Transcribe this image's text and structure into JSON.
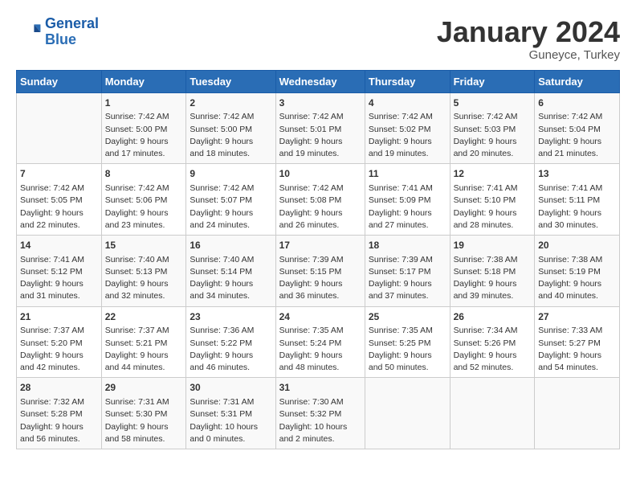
{
  "logo": {
    "line1": "General",
    "line2": "Blue"
  },
  "title": "January 2024",
  "subtitle": "Guneyce, Turkey",
  "days_header": [
    "Sunday",
    "Monday",
    "Tuesday",
    "Wednesday",
    "Thursday",
    "Friday",
    "Saturday"
  ],
  "weeks": [
    {
      "cells": [
        {
          "day": "",
          "text": ""
        },
        {
          "day": "1",
          "text": "Sunrise: 7:42 AM\nSunset: 5:00 PM\nDaylight: 9 hours\nand 17 minutes."
        },
        {
          "day": "2",
          "text": "Sunrise: 7:42 AM\nSunset: 5:00 PM\nDaylight: 9 hours\nand 18 minutes."
        },
        {
          "day": "3",
          "text": "Sunrise: 7:42 AM\nSunset: 5:01 PM\nDaylight: 9 hours\nand 19 minutes."
        },
        {
          "day": "4",
          "text": "Sunrise: 7:42 AM\nSunset: 5:02 PM\nDaylight: 9 hours\nand 19 minutes."
        },
        {
          "day": "5",
          "text": "Sunrise: 7:42 AM\nSunset: 5:03 PM\nDaylight: 9 hours\nand 20 minutes."
        },
        {
          "day": "6",
          "text": "Sunrise: 7:42 AM\nSunset: 5:04 PM\nDaylight: 9 hours\nand 21 minutes."
        }
      ]
    },
    {
      "cells": [
        {
          "day": "7",
          "text": "Sunrise: 7:42 AM\nSunset: 5:05 PM\nDaylight: 9 hours\nand 22 minutes."
        },
        {
          "day": "8",
          "text": "Sunrise: 7:42 AM\nSunset: 5:06 PM\nDaylight: 9 hours\nand 23 minutes."
        },
        {
          "day": "9",
          "text": "Sunrise: 7:42 AM\nSunset: 5:07 PM\nDaylight: 9 hours\nand 24 minutes."
        },
        {
          "day": "10",
          "text": "Sunrise: 7:42 AM\nSunset: 5:08 PM\nDaylight: 9 hours\nand 26 minutes."
        },
        {
          "day": "11",
          "text": "Sunrise: 7:41 AM\nSunset: 5:09 PM\nDaylight: 9 hours\nand 27 minutes."
        },
        {
          "day": "12",
          "text": "Sunrise: 7:41 AM\nSunset: 5:10 PM\nDaylight: 9 hours\nand 28 minutes."
        },
        {
          "day": "13",
          "text": "Sunrise: 7:41 AM\nSunset: 5:11 PM\nDaylight: 9 hours\nand 30 minutes."
        }
      ]
    },
    {
      "cells": [
        {
          "day": "14",
          "text": "Sunrise: 7:41 AM\nSunset: 5:12 PM\nDaylight: 9 hours\nand 31 minutes."
        },
        {
          "day": "15",
          "text": "Sunrise: 7:40 AM\nSunset: 5:13 PM\nDaylight: 9 hours\nand 32 minutes."
        },
        {
          "day": "16",
          "text": "Sunrise: 7:40 AM\nSunset: 5:14 PM\nDaylight: 9 hours\nand 34 minutes."
        },
        {
          "day": "17",
          "text": "Sunrise: 7:39 AM\nSunset: 5:15 PM\nDaylight: 9 hours\nand 36 minutes."
        },
        {
          "day": "18",
          "text": "Sunrise: 7:39 AM\nSunset: 5:17 PM\nDaylight: 9 hours\nand 37 minutes."
        },
        {
          "day": "19",
          "text": "Sunrise: 7:38 AM\nSunset: 5:18 PM\nDaylight: 9 hours\nand 39 minutes."
        },
        {
          "day": "20",
          "text": "Sunrise: 7:38 AM\nSunset: 5:19 PM\nDaylight: 9 hours\nand 40 minutes."
        }
      ]
    },
    {
      "cells": [
        {
          "day": "21",
          "text": "Sunrise: 7:37 AM\nSunset: 5:20 PM\nDaylight: 9 hours\nand 42 minutes."
        },
        {
          "day": "22",
          "text": "Sunrise: 7:37 AM\nSunset: 5:21 PM\nDaylight: 9 hours\nand 44 minutes."
        },
        {
          "day": "23",
          "text": "Sunrise: 7:36 AM\nSunset: 5:22 PM\nDaylight: 9 hours\nand 46 minutes."
        },
        {
          "day": "24",
          "text": "Sunrise: 7:35 AM\nSunset: 5:24 PM\nDaylight: 9 hours\nand 48 minutes."
        },
        {
          "day": "25",
          "text": "Sunrise: 7:35 AM\nSunset: 5:25 PM\nDaylight: 9 hours\nand 50 minutes."
        },
        {
          "day": "26",
          "text": "Sunrise: 7:34 AM\nSunset: 5:26 PM\nDaylight: 9 hours\nand 52 minutes."
        },
        {
          "day": "27",
          "text": "Sunrise: 7:33 AM\nSunset: 5:27 PM\nDaylight: 9 hours\nand 54 minutes."
        }
      ]
    },
    {
      "cells": [
        {
          "day": "28",
          "text": "Sunrise: 7:32 AM\nSunset: 5:28 PM\nDaylight: 9 hours\nand 56 minutes."
        },
        {
          "day": "29",
          "text": "Sunrise: 7:31 AM\nSunset: 5:30 PM\nDaylight: 9 hours\nand 58 minutes."
        },
        {
          "day": "30",
          "text": "Sunrise: 7:31 AM\nSunset: 5:31 PM\nDaylight: 10 hours\nand 0 minutes."
        },
        {
          "day": "31",
          "text": "Sunrise: 7:30 AM\nSunset: 5:32 PM\nDaylight: 10 hours\nand 2 minutes."
        },
        {
          "day": "",
          "text": ""
        },
        {
          "day": "",
          "text": ""
        },
        {
          "day": "",
          "text": ""
        }
      ]
    }
  ]
}
